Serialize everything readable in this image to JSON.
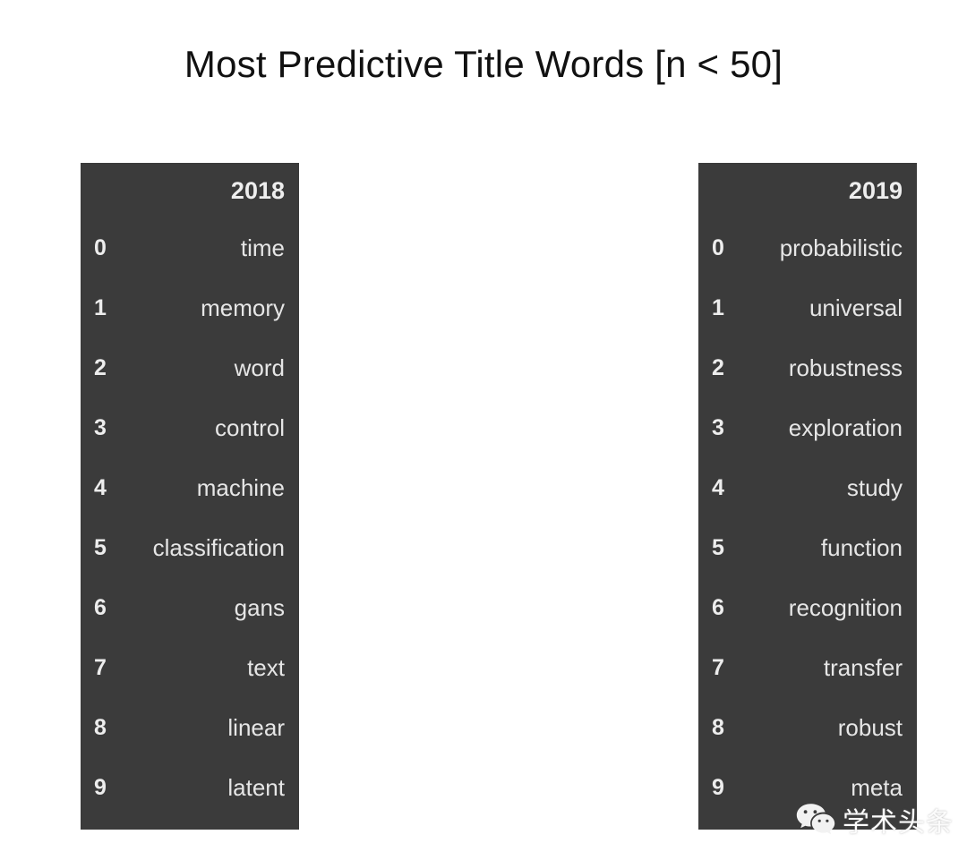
{
  "page": {
    "title": "Most Predictive Title Words [n < 50]",
    "background_color": "#ffffff",
    "panel_color": "#3b3b3b",
    "text_color": "#e6e6e6"
  },
  "chart_data": {
    "type": "table",
    "title": "Most Predictive Title Words [n < 50]",
    "xlabel": "",
    "ylabel": "",
    "tables": [
      {
        "name": "table-2018",
        "column_header": "2018",
        "index": [
          0,
          1,
          2,
          3,
          4,
          5,
          6,
          7,
          8,
          9
        ],
        "values": [
          "time",
          "memory",
          "word",
          "control",
          "machine",
          "classification",
          "gans",
          "text",
          "linear",
          "latent"
        ]
      },
      {
        "name": "table-2019",
        "column_header": "2019",
        "index": [
          0,
          1,
          2,
          3,
          4,
          5,
          6,
          7,
          8,
          9
        ],
        "values": [
          "probabilistic",
          "universal",
          "robustness",
          "exploration",
          "study",
          "function",
          "recognition",
          "transfer",
          "robust",
          "meta"
        ]
      }
    ]
  },
  "watermark": {
    "text": "学术头条",
    "icon": "wechat-icon"
  }
}
